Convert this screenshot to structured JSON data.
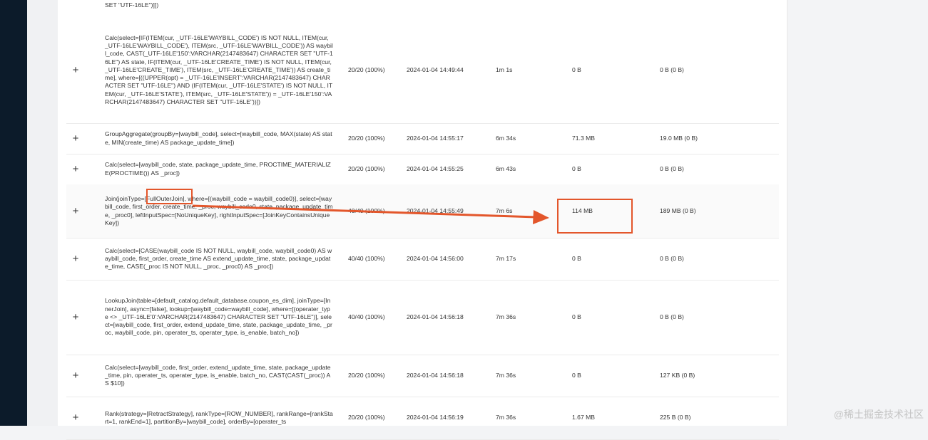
{
  "table": {
    "top_fragment": "SET \"UTF-16LE\")]])",
    "rows": [
      {
        "expand": "+",
        "name": "Calc(select=[IF(ITEM(cur, _UTF-16LE'WAYBILL_CODE') IS NOT NULL, ITEM(cur, _UTF-16LE'WAYBILL_CODE'), ITEM(src, _UTF-16LE'WAYBILL_CODE')) AS waybill_code, CAST(_UTF-16LE'150':VARCHAR(2147483647) CHARACTER SET \"UTF-16LE\") AS state, IF(ITEM(cur, _UTF-16LE'CREATE_TIME') IS NOT NULL, ITEM(cur, _UTF-16LE'CREATE_TIME'), ITEM(src, _UTF-16LE'CREATE_TIME')) AS create_time], where=[((UPPER(opt) = _UTF-16LE'INSERT':VARCHAR(2147483647) CHARACTER SET \"UTF-16LE\") AND (IF(ITEM(cur, _UTF-16LE'STATE') IS NOT NULL, ITEM(cur, _UTF-16LE'STATE'), ITEM(src, _UTF-16LE'STATE')) = _UTF-16LE'150':VARCHAR(2147483647) CHARACTER SET \"UTF-16LE\"))])",
        "parallelism": "20/20 (100%)",
        "start_time": "2024-01-04 14:49:44",
        "duration": "1m 1s",
        "state_size": "0 B",
        "output": "0 B (0 B)"
      },
      {
        "expand": "+",
        "name": "GroupAggregate(groupBy=[waybill_code], select=[waybill_code, MAX(state) AS state, MIN(create_time) AS package_update_time])",
        "parallelism": "20/20 (100%)",
        "start_time": "2024-01-04 14:55:17",
        "duration": "6m 34s",
        "state_size": "71.3 MB",
        "output": "19.0 MB (0 B)"
      },
      {
        "expand": "+",
        "name": "Calc(select=[waybill_code, state, package_update_time, PROCTIME_MATERIALIZE(PROCTIME()) AS _proc])",
        "parallelism": "20/20 (100%)",
        "start_time": "2024-01-04 14:55:25",
        "duration": "6m 43s",
        "state_size": "0 B",
        "output": "0 B (0 B)"
      },
      {
        "expand": "+",
        "name": "Join(joinType=[FullOuterJoin], where=[(waybill_code = waybill_code0)], select=[waybill_code, first_order, create_time, _proc, waybill_code0, state, package_update_time, _proc0], leftInputSpec=[NoUniqueKey], rightInputSpec=[JoinKeyContainsUniqueKey])",
        "parallelism": "40/40 (100%)",
        "start_time": "2024-01-04 14:55:49",
        "duration": "7m 6s",
        "state_size": "114 MB",
        "output": "189 MB (0 B)"
      },
      {
        "expand": "+",
        "name": "Calc(select=[CASE(waybill_code IS NOT NULL, waybill_code, waybill_code0) AS waybill_code, first_order, create_time AS extend_update_time, state, package_update_time, CASE(_proc IS NOT NULL, _proc, _proc0) AS _proc])",
        "parallelism": "40/40 (100%)",
        "start_time": "2024-01-04 14:56:00",
        "duration": "7m 17s",
        "state_size": "0 B",
        "output": "0 B (0 B)"
      },
      {
        "expand": "+",
        "name": "LookupJoin(table=[default_catalog.default_database.coupon_es_dim], joinType=[InnerJoin], async=[false], lookup=[waybill_code=waybill_code], where=[(operater_type <> _UTF-16LE'0':VARCHAR(2147483647) CHARACTER SET \"UTF-16LE\")], select=[waybill_code, first_order, extend_update_time, state, package_update_time, _proc, waybill_code, pin, operater_ts, operater_type, is_enable, batch_no])",
        "parallelism": "40/40 (100%)",
        "start_time": "2024-01-04 14:56:18",
        "duration": "7m 36s",
        "state_size": "0 B",
        "output": "0 B (0 B)"
      },
      {
        "expand": "+",
        "name": "Calc(select=[waybill_code, first_order, extend_update_time, state, package_update_time, pin, operater_ts, operater_type, is_enable, batch_no, CAST(CAST(_proc)) AS $10])",
        "parallelism": "20/20 (100%)",
        "start_time": "2024-01-04 14:56:18",
        "duration": "7m 36s",
        "state_size": "0 B",
        "output": "127 KB (0 B)"
      },
      {
        "expand": "+",
        "name": "Rank(strategy=[RetractStrategy], rankType=[ROW_NUMBER], rankRange=[rankStart=1, rankEnd=1], partitionBy=[waybill_code], orderBy=[operater_ts",
        "parallelism": "20/20 (100%)",
        "start_time": "2024-01-04 14:56:19",
        "duration": "7m 36s",
        "state_size": "1.67 MB",
        "output": "225 B (0 B)"
      }
    ]
  },
  "watermark": "@稀土掘金技术社区",
  "colors": {
    "annotation": "#e3562b",
    "sidebar": "#0c1b2a"
  }
}
